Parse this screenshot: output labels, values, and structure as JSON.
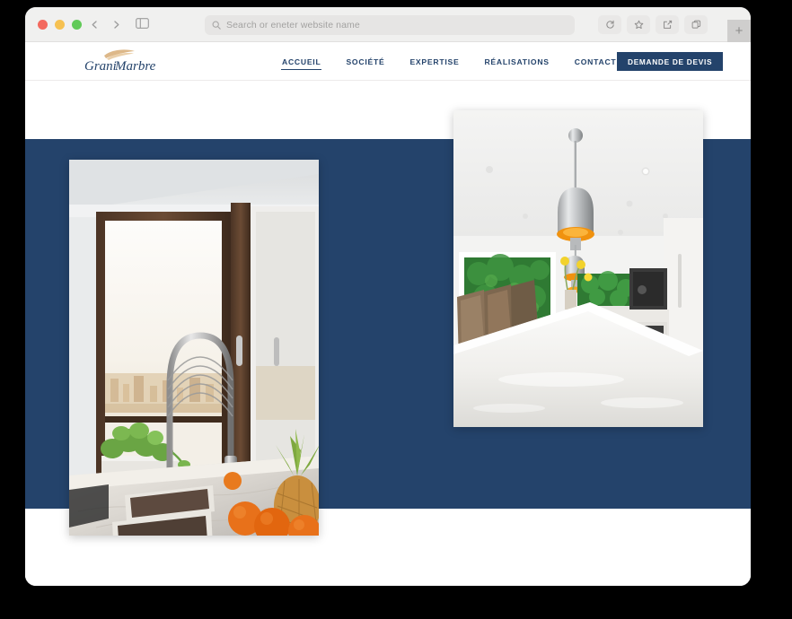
{
  "browser": {
    "traffic_lights": [
      "close",
      "minimize",
      "maximize"
    ],
    "back_icon": "chevron-left-icon",
    "forward_icon": "chevron-right-icon",
    "sidebar_icon": "sidebar-toggle-icon",
    "search_icon": "search-icon",
    "address_placeholder": "Search or eneter website name",
    "address_value": "",
    "toolbar_icons": [
      "reload-icon",
      "bookmark-star-icon",
      "share-icon",
      "tabs-icon"
    ],
    "new_tab_label": "+"
  },
  "site": {
    "logo_text": "GraniMarbre",
    "logo_colors": {
      "text": "#24436b",
      "swoosh": "#d9b07c"
    },
    "nav": [
      {
        "label": "ACCUEIL",
        "active": true
      },
      {
        "label": "SOCIÉTÉ",
        "active": false
      },
      {
        "label": "EXPERTISE",
        "active": false
      },
      {
        "label": "RÉALISATIONS",
        "active": false
      },
      {
        "label": "CONTACT",
        "active": false
      }
    ],
    "cta_label": "DEMANDE DE DEVIS",
    "colors": {
      "navy": "#24436b",
      "cta_bg": "#24436b",
      "cta_text": "#ffffff",
      "page_bg": "#ffffff"
    },
    "hero": {
      "band_color": "#24436b",
      "images": [
        {
          "name": "kitchen-window-sink-photo",
          "alt": "Marble countertop kitchen with double undermount sinks, arched chrome faucet, large dark-framed window, herb planter, oranges and a pineapple"
        },
        {
          "name": "white-kitchen-island-photo",
          "alt": "Modern white kitchen with long island counter, chrome pendant lamps with orange interiors, rattan chairs and green foliage through windows"
        }
      ]
    }
  }
}
